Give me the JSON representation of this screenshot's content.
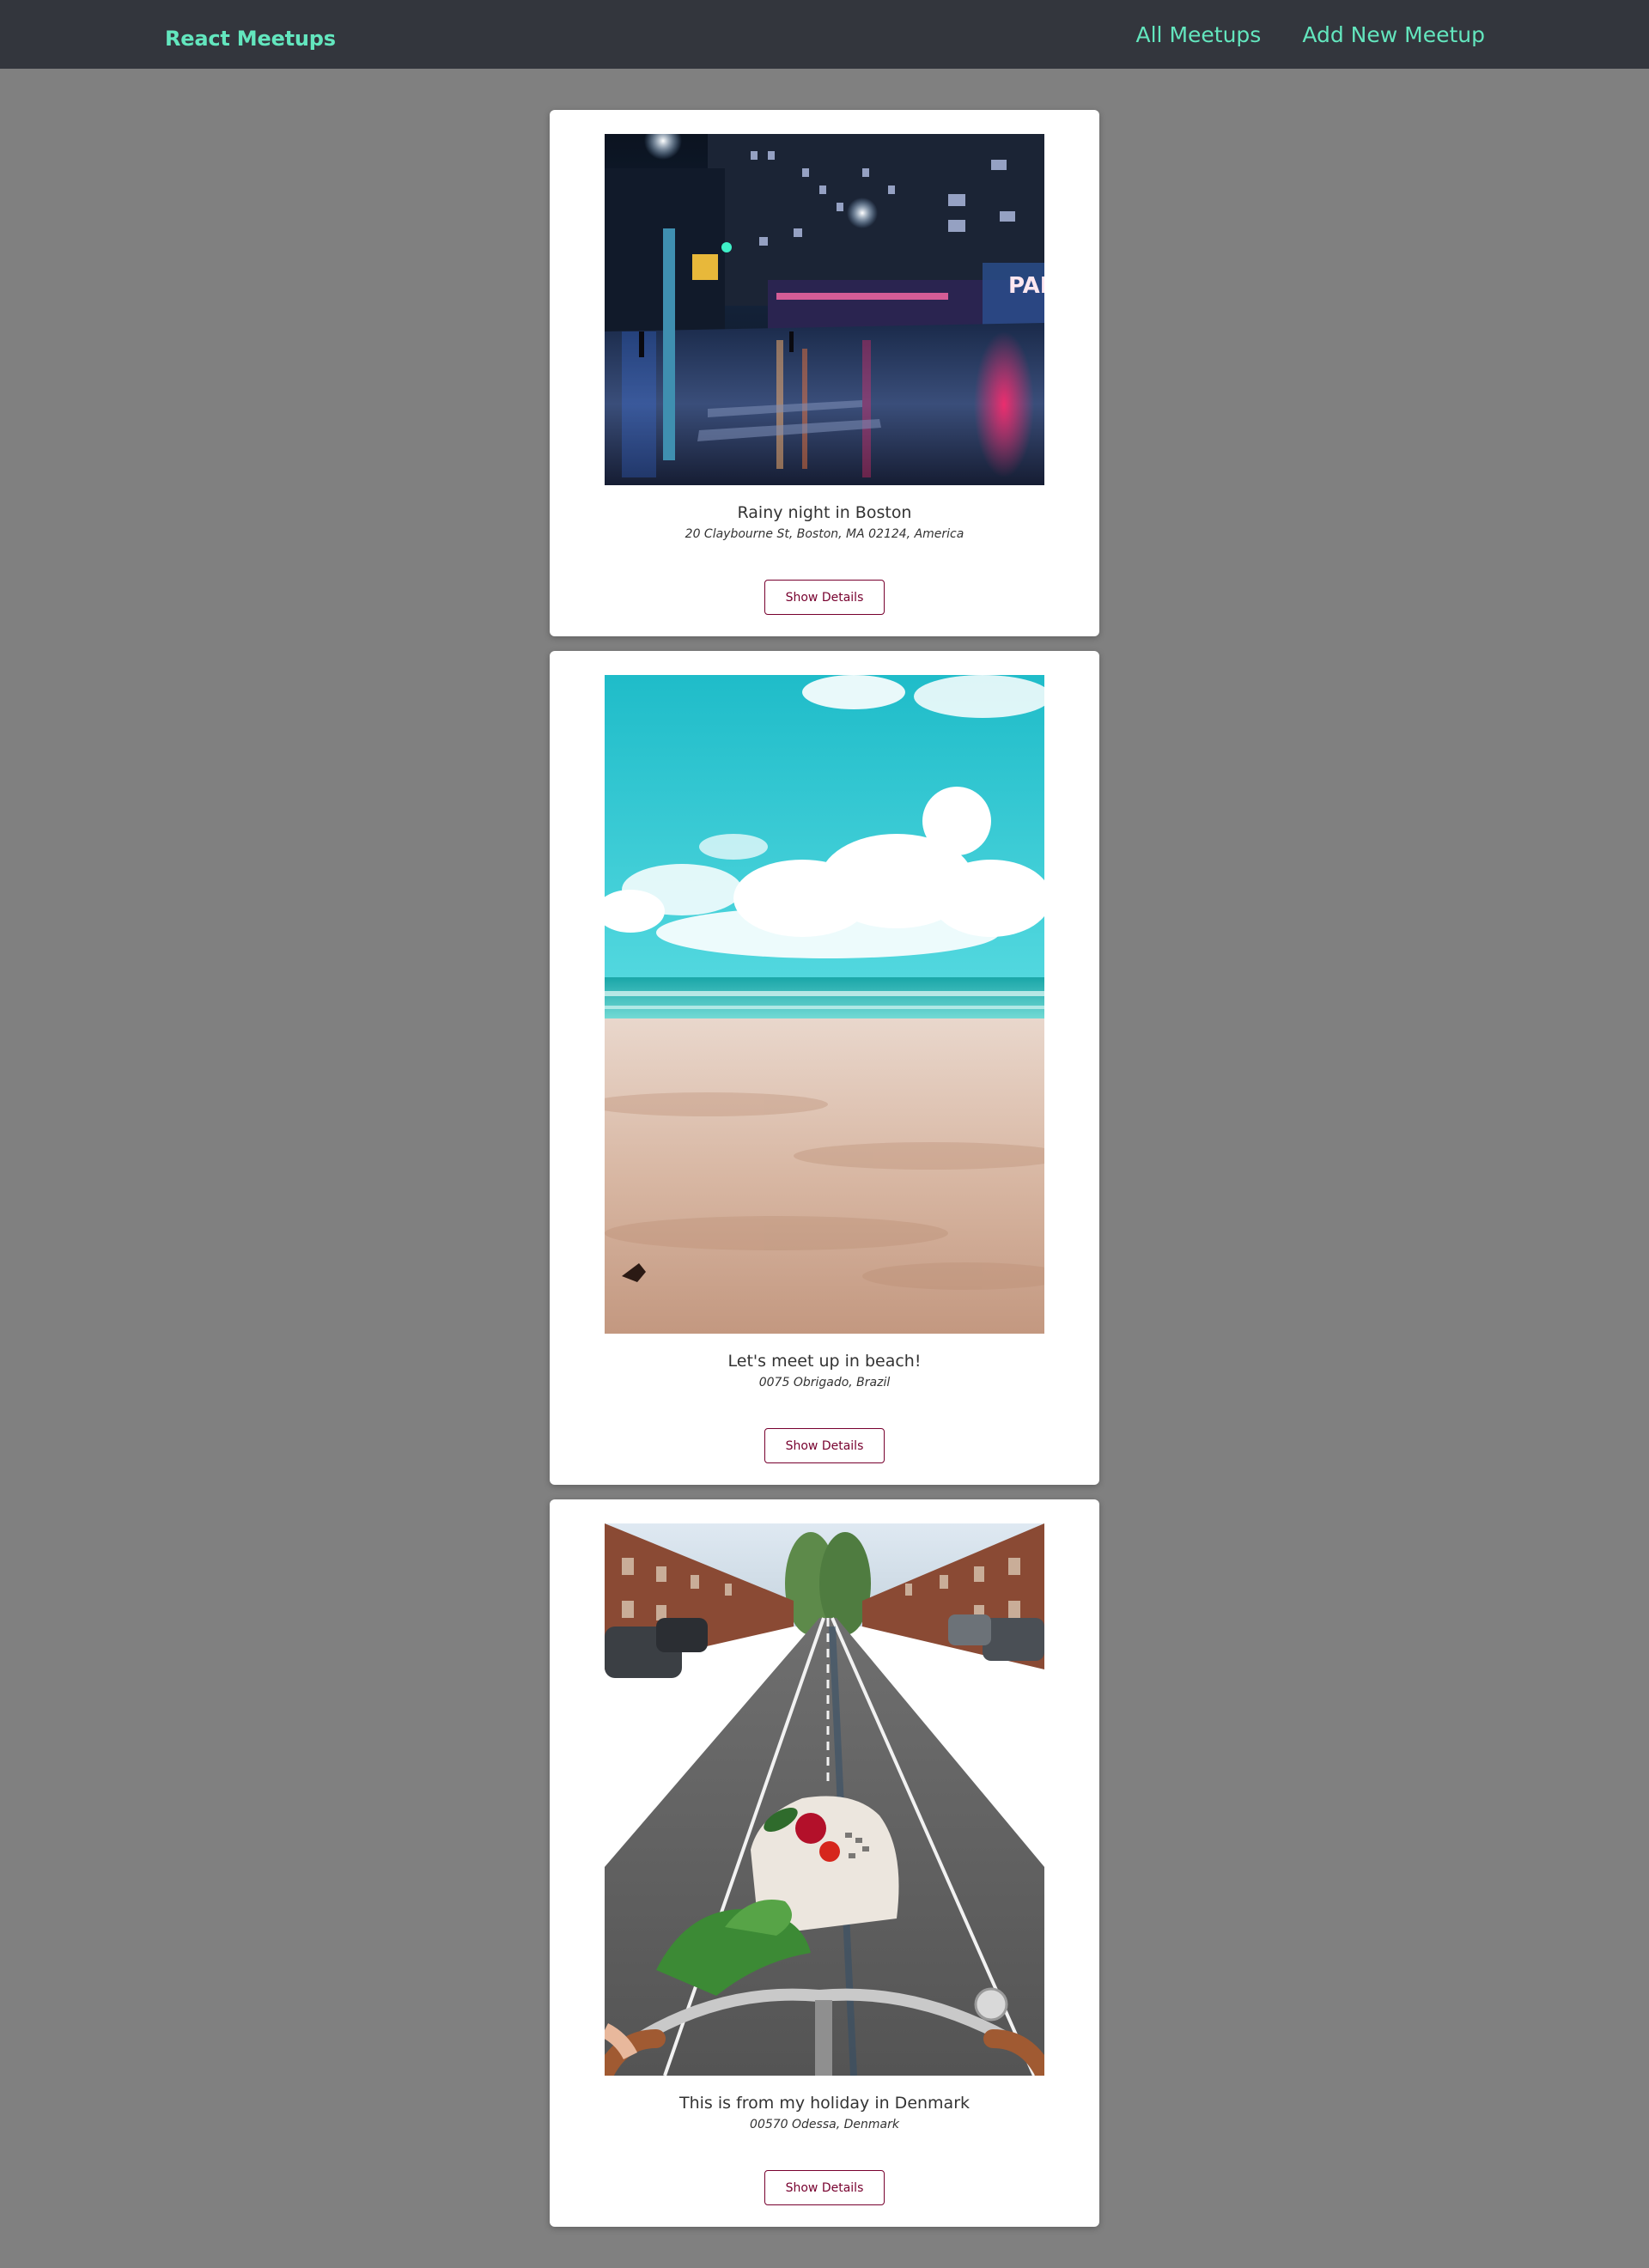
{
  "header": {
    "logo": "React Meetups",
    "nav": [
      {
        "label": "All Meetups"
      },
      {
        "label": "Add New Meetup"
      }
    ]
  },
  "meetups": [
    {
      "title": "Rainy night in Boston",
      "address": "20 Claybourne St, Boston, MA 02124, America",
      "button_label": "Show Details",
      "image_sign": "PAR"
    },
    {
      "title": "Let's meet up in beach!",
      "address": "0075 Obrigado, Brazil",
      "button_label": "Show Details"
    },
    {
      "title": "This is from my holiday in Denmark",
      "address": "00570 Odessa, Denmark",
      "button_label": "Show Details"
    }
  ],
  "colors": {
    "page_background": "#808080",
    "header_background": "#33363d",
    "accent": "#63e6be",
    "button_border": "#77002e"
  }
}
